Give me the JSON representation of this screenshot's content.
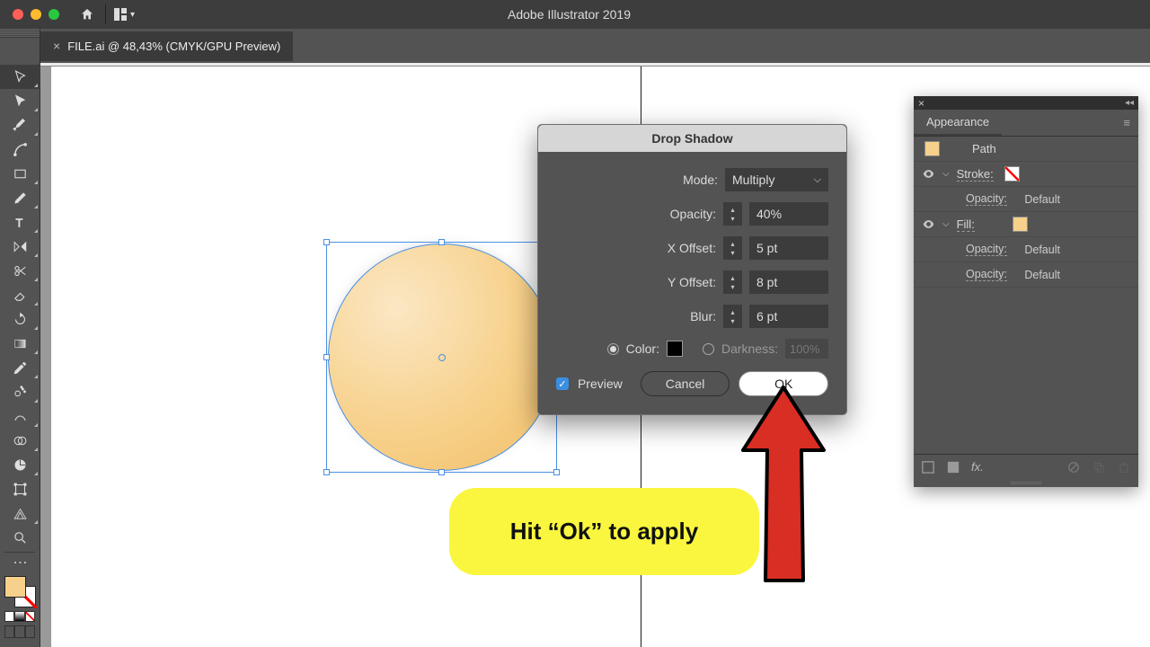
{
  "app": {
    "title": "Adobe Illustrator 2019"
  },
  "document": {
    "tab_label": "FILE.ai @ 48,43% (CMYK/GPU Preview)"
  },
  "dialog": {
    "title": "Drop Shadow",
    "mode": {
      "label": "Mode:",
      "value": "Multiply"
    },
    "opacity": {
      "label": "Opacity:",
      "value": "40%"
    },
    "xoffset": {
      "label": "X Offset:",
      "value": "5 pt"
    },
    "yoffset": {
      "label": "Y Offset:",
      "value": "8 pt"
    },
    "blur": {
      "label": "Blur:",
      "value": "6 pt"
    },
    "color_label": "Color:",
    "darkness_label": "Darkness:",
    "darkness_value": "100%",
    "preview_label": "Preview",
    "cancel": "Cancel",
    "ok": "OK"
  },
  "appearance": {
    "tab": "Appearance",
    "object": "Path",
    "stroke_label": "Stroke:",
    "fill_label": "Fill:",
    "opacity_label": "Opacity:",
    "opacity_value": "Default",
    "fx_label": "fx."
  },
  "callout": {
    "text": "Hit “Ok” to apply"
  }
}
